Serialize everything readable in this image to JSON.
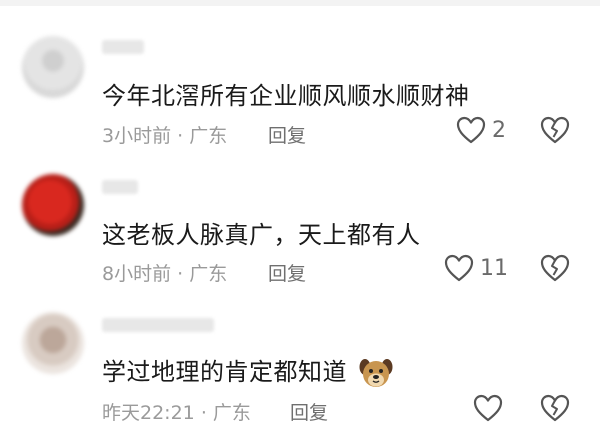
{
  "comments": [
    {
      "text": "今年北滘所有企业顺风顺水顺财神",
      "time": "3小时前",
      "location": "广东",
      "reply_label": "回复",
      "likes": "2"
    },
    {
      "text": "这老板人脉真广，天上都有人",
      "time": "8小时前",
      "location": "广东",
      "reply_label": "回复",
      "likes": "11"
    },
    {
      "text": "学过地理的肯定都知道",
      "time": "昨天22:21",
      "location": "广东",
      "reply_label": "回复",
      "likes": ""
    }
  ],
  "separator": "·",
  "icons": {
    "like": "heart-outline-icon",
    "dislike": "broken-heart-icon",
    "emoji": "dog-face-emoji"
  }
}
